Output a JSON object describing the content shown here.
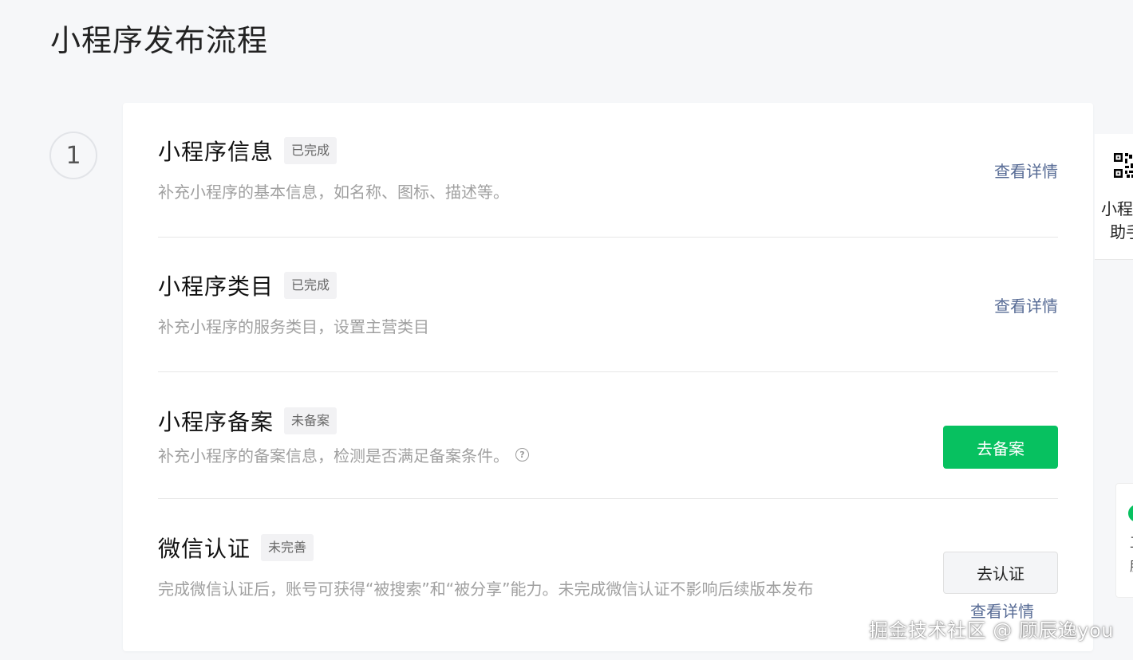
{
  "page": {
    "title": "小程序发布流程"
  },
  "step": {
    "number": "1"
  },
  "items": [
    {
      "title": "小程序信息",
      "badge": "已完成",
      "description": "补充小程序的基本信息，如名称、图标、描述等。",
      "action": "查看详情"
    },
    {
      "title": "小程序类目",
      "badge": "已完成",
      "description": "补充小程序的服务类目，设置主营类目",
      "action": "查看详情"
    },
    {
      "title": "小程序备案",
      "badge": "未备案",
      "description": "补充小程序的备案信息，检测是否满足备案条件。",
      "help_icon": "question-circle-icon",
      "action": "去备案"
    },
    {
      "title": "微信认证",
      "badge": "未完善",
      "description": "完成微信认证后，账号可获得“被搜索”和“被分享”能力。未完成微信认证不影响后续版本发布",
      "action": "去认证",
      "secondary_action": "查看详情"
    }
  ],
  "side_panel": {
    "icon": "qr-code-icon",
    "label_line1": "小程",
    "label_line2": "助手"
  },
  "side_panel_2": {
    "icon": "green-status-dot",
    "frag1": "卫",
    "frag2": "肝"
  },
  "watermark": "掘金技术社区 @ 顾辰逸you",
  "colors": {
    "primary": "#07c160",
    "link": "#576b95",
    "background": "#f6f7f9"
  }
}
